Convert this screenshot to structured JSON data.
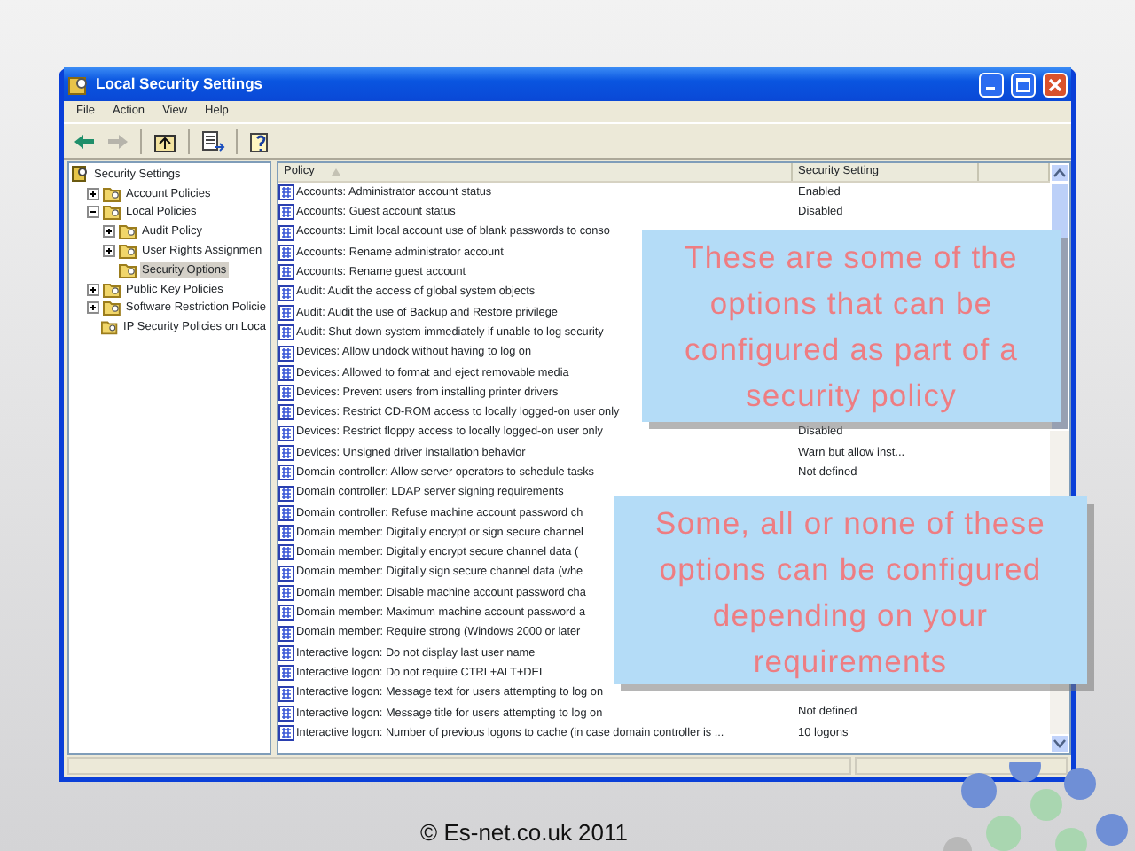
{
  "window": {
    "title": "Local Security Settings",
    "menu": [
      "File",
      "Action",
      "View",
      "Help"
    ],
    "toolbar": [
      {
        "kind": "back",
        "disabled": false
      },
      {
        "kind": "forward",
        "disabled": true
      },
      {
        "kind": "up",
        "disabled": false
      },
      {
        "kind": "export",
        "disabled": false
      },
      {
        "kind": "help",
        "disabled": false
      }
    ],
    "tree": [
      {
        "label": "Security Settings",
        "kind": "root",
        "children": [
          {
            "label": "Account Policies",
            "expanded": false,
            "selected": false
          },
          {
            "label": "Local Policies",
            "expanded": true,
            "selected": false,
            "children": [
              {
                "label": "Audit Policy",
                "expanded": false,
                "selected": false
              },
              {
                "label": "User Rights Assignmen",
                "expanded": false,
                "selected": false
              },
              {
                "label": "Security Options",
                "selected": true
              }
            ]
          },
          {
            "label": "Public Key Policies",
            "expanded": false,
            "selected": false
          },
          {
            "label": "Software Restriction Policie",
            "expanded": false,
            "selected": false
          },
          {
            "label": "IP Security Policies on Loca",
            "selected": false
          }
        ]
      }
    ],
    "columns": [
      "Policy",
      "Security Setting"
    ],
    "rows": [
      {
        "policy": "Accounts: Administrator account status",
        "setting": "Enabled"
      },
      {
        "policy": "Accounts: Guest account status",
        "setting": "Disabled"
      },
      {
        "policy": "Accounts: Limit local account use of blank passwords to conso"
      },
      {
        "policy": "Accounts: Rename administrator account"
      },
      {
        "policy": "Accounts: Rename guest account"
      },
      {
        "policy": "Audit: Audit the access of global system objects"
      },
      {
        "policy": "Audit: Audit the use of Backup and Restore privilege"
      },
      {
        "policy": "Audit: Shut down system immediately if unable to log security"
      },
      {
        "policy": "Devices: Allow undock without having to log on"
      },
      {
        "policy": "Devices: Allowed to format and eject removable media"
      },
      {
        "policy": "Devices: Prevent users from installing printer drivers"
      },
      {
        "policy": "Devices: Restrict CD-ROM access to locally logged-on user only"
      },
      {
        "policy": "Devices: Restrict floppy access to locally logged-on user only",
        "setting": "Disabled"
      },
      {
        "policy": "Devices: Unsigned driver installation behavior",
        "setting": "Warn but allow inst..."
      },
      {
        "policy": "Domain controller: Allow server operators to schedule tasks",
        "setting": "Not defined"
      },
      {
        "policy": "Domain controller: LDAP server signing requirements"
      },
      {
        "policy": "Domain controller: Refuse machine account password ch"
      },
      {
        "policy": "Domain member: Digitally encrypt or sign secure channel"
      },
      {
        "policy": "Domain member: Digitally encrypt secure channel data ("
      },
      {
        "policy": "Domain member: Digitally sign secure channel data (whe"
      },
      {
        "policy": "Domain member: Disable machine account password cha"
      },
      {
        "policy": "Domain member: Maximum machine account password a"
      },
      {
        "policy": "Domain member: Require strong (Windows 2000 or later"
      },
      {
        "policy": "Interactive logon: Do not display last user name"
      },
      {
        "policy": "Interactive logon: Do not require CTRL+ALT+DEL"
      },
      {
        "policy": "Interactive logon: Message text for users attempting to log on"
      },
      {
        "policy": "Interactive logon: Message title for users attempting to log on",
        "setting": "Not defined"
      },
      {
        "policy": "Interactive logon: Number of previous logons to cache (in case domain controller is ...",
        "setting": "10 logons"
      }
    ]
  },
  "callouts": [
    {
      "text": "These are some of the options that can be configured as part of a security policy"
    },
    {
      "text": "Some, all or none of these options can be configured depending on your requirements"
    }
  ],
  "footer": "© Es-net.co.uk 2011"
}
